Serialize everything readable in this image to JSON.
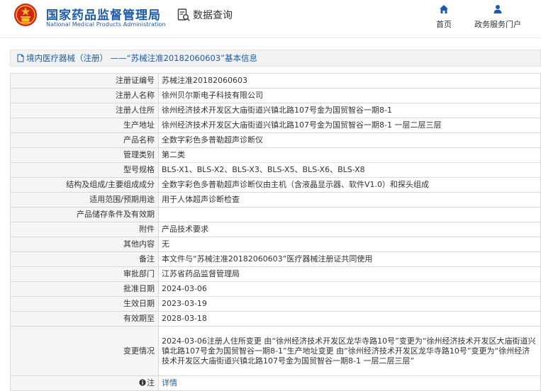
{
  "header": {
    "brand_cn": "国家药品监督管理局",
    "brand_en": "National Medical Products Administration",
    "search_title": "数据查询",
    "nav": [
      {
        "label": "首页",
        "icon": "home-icon"
      },
      {
        "label": "政务服务门户",
        "icon": "user-icon"
      }
    ],
    "brand_color": "#1f5aa8"
  },
  "breadcrumb": {
    "text": "境内医疗器械（注册） ——“苏械注准20182060603”基本信息"
  },
  "rows": [
    {
      "label": "注册证编号",
      "value": "苏械注准20182060603"
    },
    {
      "label": "注册人名称",
      "value": "徐州贝尔斯电子科技有限公司"
    },
    {
      "label": "注册人住所",
      "value": "徐州经济技术开发区大庙街道兴镇北路107号金为国贸智谷一期8-1"
    },
    {
      "label": "生产地址",
      "value": "徐州经济技术开发区大庙街道兴镇北路107号金为国贸智谷一期8-1 一层二层三层"
    },
    {
      "label": "产品名称",
      "value": "全数字彩色多普勒超声诊断仪"
    },
    {
      "label": "管理类别",
      "value": "第二类"
    },
    {
      "label": "型号规格",
      "value": "BLS-X1、BLS-X2、BLS-X3、BLS-X5、BLS-X6、BLS-X8"
    },
    {
      "label": "结构及组成/主要组成成分",
      "value": "全数字彩色多普勒超声诊断仪由主机（含液晶显示器、软件V1.0）和探头组成"
    },
    {
      "label": "适用范围/预期用途",
      "value": "用于人体超声诊断检查"
    },
    {
      "label": "产品储存条件及有效期",
      "value": ""
    },
    {
      "label": "附件",
      "value": "产品技术要求"
    },
    {
      "label": "其他内容",
      "value": "无"
    },
    {
      "label": "备注",
      "value": "本文件与“苏械注准20182060603”医疗器械注册证共同使用"
    },
    {
      "label": "审批部门",
      "value": "江苏省药品监督管理局"
    },
    {
      "label": "批准日期",
      "value": "2024-03-06"
    },
    {
      "label": "生效日期",
      "value": "2023-03-19"
    },
    {
      "label": "有效期至",
      "value": "2028-03-18"
    },
    {
      "label": "变更情况",
      "value": "2024-03-06注册人住所变更 由“徐州经济技术开发区龙华寺路10号”变更为“徐州经济技术开发区大庙街道兴镇北路107号金为国贸智谷一期8-1”生产地址变更 由“徐州经济技术开发区龙华寺路10号”变更为“徐州经济技术开发区大庙街道兴镇北路107号金为国贸智谷一期8-1 一层二层三层”"
    }
  ],
  "note": {
    "label": "注",
    "link": "详情"
  }
}
